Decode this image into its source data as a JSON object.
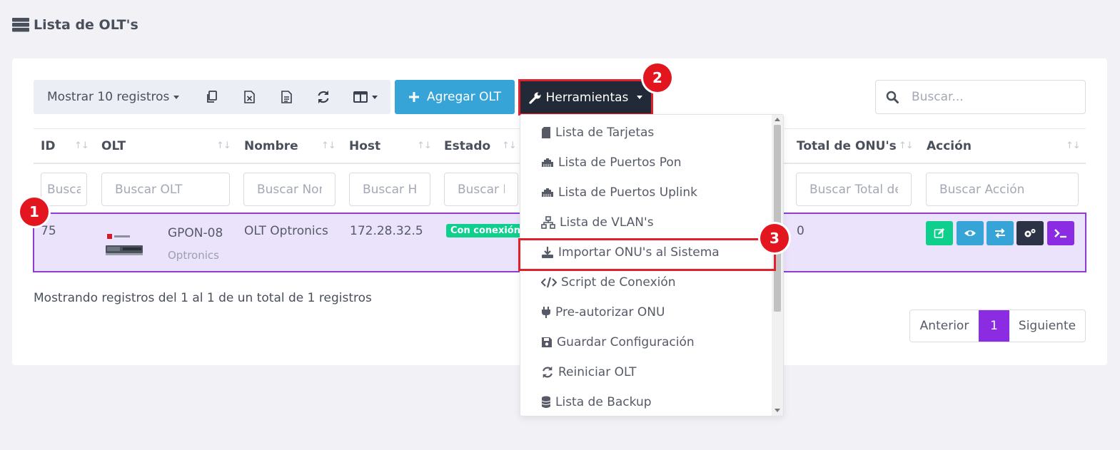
{
  "page": {
    "title": "Lista de OLT's"
  },
  "toolbar": {
    "show_label": "Mostrar 10 registros",
    "add_label": "Agregar OLT",
    "tools_label": "Herramientas"
  },
  "search": {
    "placeholder": "Buscar..."
  },
  "table": {
    "headers": {
      "id": "ID",
      "olt": "OLT",
      "nombre": "Nombre",
      "host": "Host",
      "estado": "Estado",
      "total_onus": "Total de ONU's",
      "accion": "Acción"
    },
    "filters": {
      "id": "Buscar ID",
      "olt": "Buscar OLT",
      "nombre": "Buscar Nombre",
      "host": "Buscar Host",
      "estado": "Buscar Estado",
      "total_onus": "Buscar Total de ONU's",
      "accion": "Buscar Acción"
    },
    "rows": [
      {
        "id": "75",
        "olt_name": "GPON-08",
        "olt_brand": "Optronics",
        "nombre": "OLT Optronics",
        "host": "172.28.32.5",
        "estado": "Con conexión",
        "total_onus": "0"
      }
    ]
  },
  "footer": {
    "info": "Mostrando registros del 1 al 1 de un total de 1 registros"
  },
  "pagination": {
    "prev": "Anterior",
    "current": "1",
    "next": "Siguiente"
  },
  "dropdown": {
    "items": [
      {
        "label": "Lista de Tarjetas",
        "icon": "sd-card-icon"
      },
      {
        "label": "Lista de Puertos Pon",
        "icon": "ethernet-icon"
      },
      {
        "label": "Lista de Puertos Uplink",
        "icon": "ethernet-icon"
      },
      {
        "label": "Lista de VLAN's",
        "icon": "network-icon"
      },
      {
        "label": "Importar ONU's al Sistema",
        "icon": "download-icon"
      },
      {
        "label": "Script de Conexión",
        "icon": "code-icon"
      },
      {
        "label": "Pre-autorizar ONU",
        "icon": "plug-icon"
      },
      {
        "label": "Guardar Configuración",
        "icon": "save-icon"
      },
      {
        "label": "Reiniciar OLT",
        "icon": "sync-icon"
      },
      {
        "label": "Lista de Backup",
        "icon": "database-icon"
      }
    ]
  },
  "annotations": {
    "badge_1": "1",
    "badge_2": "2",
    "badge_3": "3"
  },
  "colors": {
    "primary_blue": "#36a4d6",
    "dark": "#232a37",
    "purple": "#8b2be2",
    "green": "#0fcf8d",
    "highlight_red": "#e3151e",
    "row_highlight": "#ebe3fb"
  }
}
